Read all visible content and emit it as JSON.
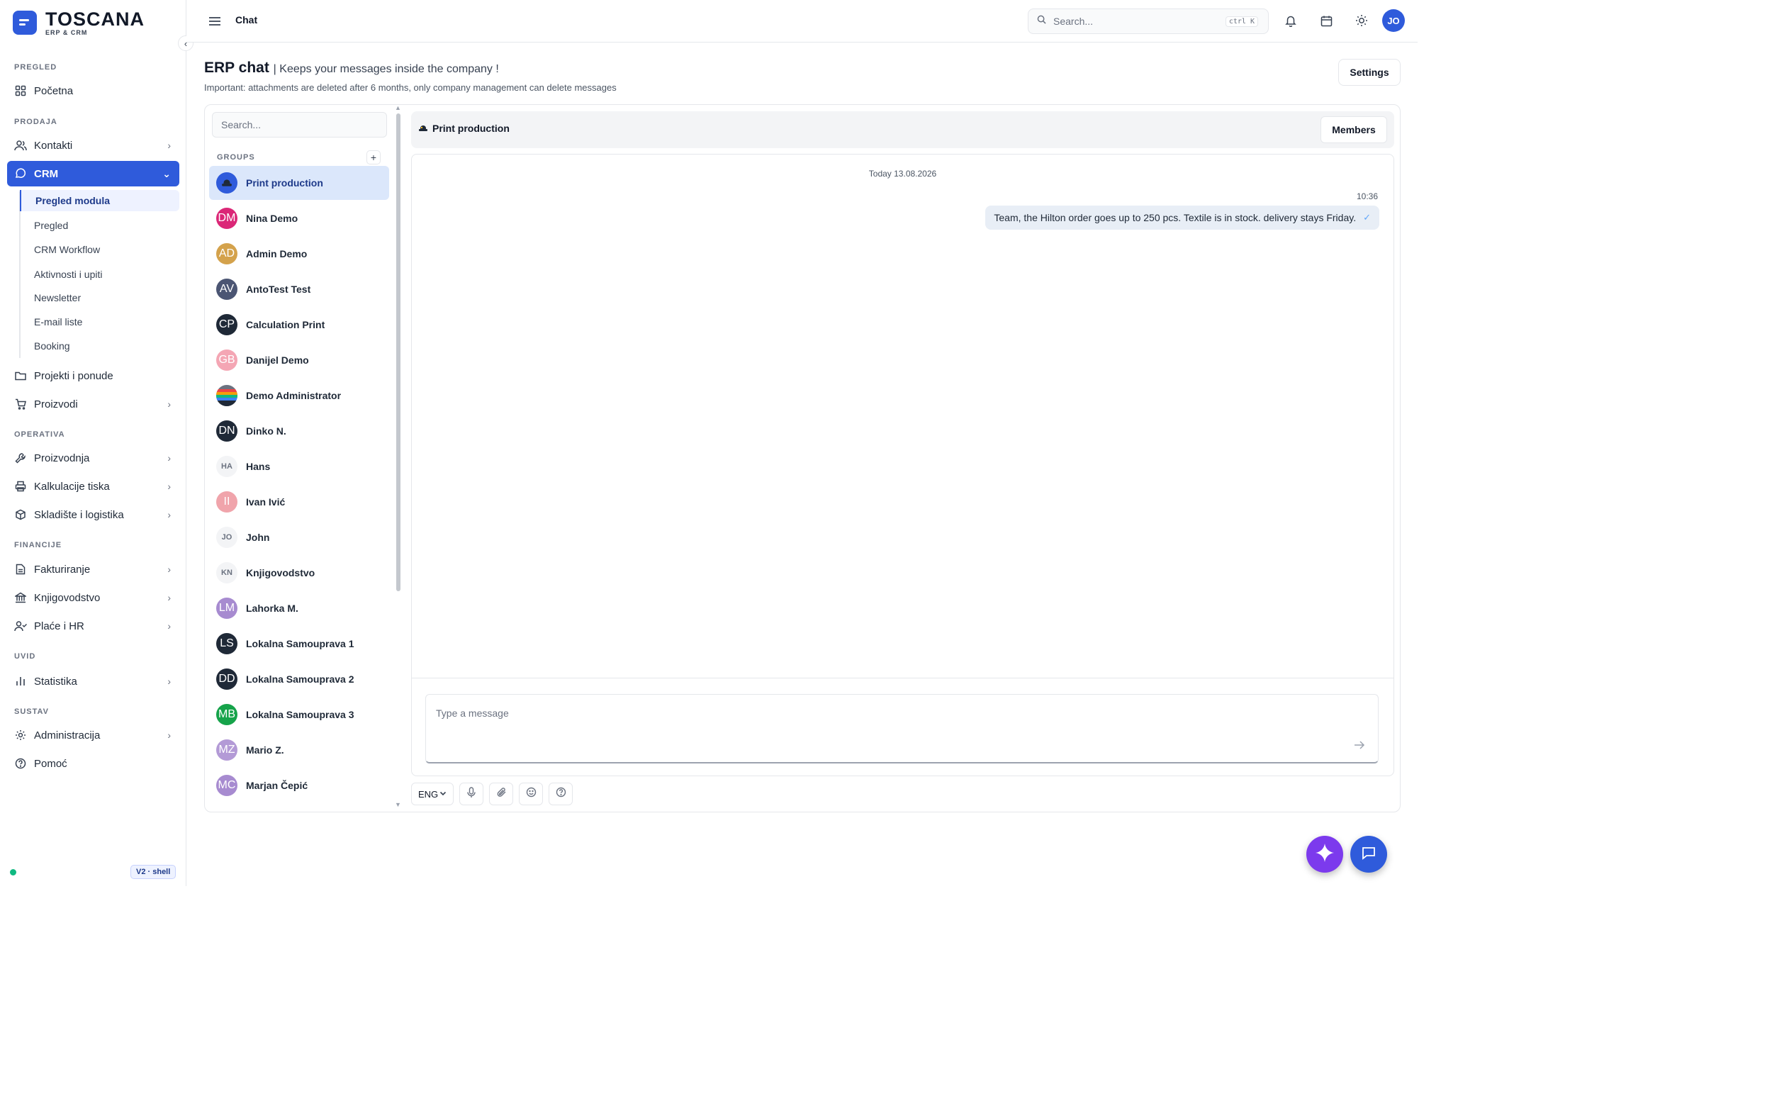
{
  "brand": {
    "title": "TOSCANA",
    "subtitle": "ERP & CRM"
  },
  "topbar": {
    "title": "Chat",
    "search_placeholder": "Search...",
    "shortcut": "ctrl K",
    "user_initials": "JO"
  },
  "sidebar": {
    "sections": {
      "pregled": "PREGLED",
      "prodaja": "PRODAJA",
      "operativa": "OPERATIVA",
      "financije": "FINANCIJE",
      "uvid": "UVID",
      "sustav": "SUSTAV"
    },
    "items": {
      "pocetna": "Početna",
      "kontakti": "Kontakti",
      "crm": "CRM",
      "projekti": "Projekti i ponude",
      "proizvodi": "Proizvodi",
      "proizvodnja": "Proizvodnja",
      "kalkulacije": "Kalkulacije tiska",
      "skladiste": "Skladište i logistika",
      "fakturiranje": "Fakturiranje",
      "knjigovodstvo": "Knjigovodstvo",
      "place": "Plaće i HR",
      "statistika": "Statistika",
      "administracija": "Administracija",
      "pomoc": "Pomoć"
    },
    "crm_sub": [
      "Pregled modula",
      "Pregled",
      "CRM Workflow",
      "Aktivnosti i upiti",
      "Newsletter",
      "E-mail liste",
      "Booking"
    ],
    "version": "V2 · shell"
  },
  "page": {
    "title": "ERP chat",
    "subtitle": "| Keeps your messages inside the company !",
    "note": "Important: attachments are deleted after 6 months, only company management can delete messages",
    "settings_label": "Settings"
  },
  "chat": {
    "search_placeholder": "Search...",
    "groups_label": "GROUPS",
    "groups_add": "+",
    "contacts": [
      {
        "name": "Print production",
        "initials": "",
        "color": "#2f5bdb"
      },
      {
        "name": "Nina Demo",
        "initials": "DM",
        "color": "#db2777"
      },
      {
        "name": "Admin Demo",
        "initials": "AD",
        "color": "#d4a24c"
      },
      {
        "name": "AntoTest Test",
        "initials": "AV",
        "color": "#4b5573"
      },
      {
        "name": "Calculation Print",
        "initials": "CP",
        "color": "#1f2937"
      },
      {
        "name": "Danijel Demo",
        "initials": "GB",
        "color": "#f4a6b4"
      },
      {
        "name": "Demo Administrator",
        "initials": "",
        "color": "#6b7280"
      },
      {
        "name": "Dinko N.",
        "initials": "DN",
        "color": "#1f2937"
      },
      {
        "name": "Hans",
        "initials": "HA",
        "color": "#f3f4f6"
      },
      {
        "name": "Ivan Ivić",
        "initials": "II",
        "color": "#f0a4ab"
      },
      {
        "name": "John",
        "initials": "JO",
        "color": "#f3f4f6"
      },
      {
        "name": "Knjigovodstvo",
        "initials": "KN",
        "color": "#f3f4f6"
      },
      {
        "name": "Lahorka M.",
        "initials": "LM",
        "color": "#a78bd0"
      },
      {
        "name": "Lokalna Samouprava 1",
        "initials": "LS",
        "color": "#1f2937"
      },
      {
        "name": "Lokalna Samouprava 2",
        "initials": "DD",
        "color": "#1f2937"
      },
      {
        "name": "Lokalna Samouprava 3",
        "initials": "MB",
        "color": "#16a34a"
      },
      {
        "name": "Mario Z.",
        "initials": "MZ",
        "color": "#b39ad6"
      },
      {
        "name": "Marjan Čepić",
        "initials": "MC",
        "color": "#a78bd0"
      }
    ],
    "conversation": {
      "name": "Print production",
      "members_label": "Members",
      "date_label": "Today 13.08.2026",
      "message_time": "10:36",
      "message_text": "Team, the Hilton order goes up to 250 pcs. Textile is in stock. delivery stays Friday.",
      "composer_placeholder": "Type a message",
      "language": "ENG"
    }
  },
  "colors": {
    "accent": "#2f5bdb",
    "ai": "#7c3aed"
  }
}
